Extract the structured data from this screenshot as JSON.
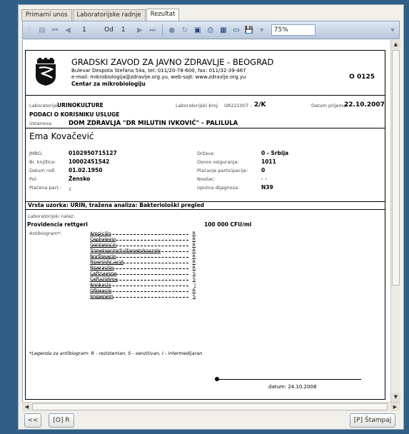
{
  "tabs": [
    {
      "label": "Primarni unos",
      "active": false
    },
    {
      "label": "Laboratorijske radnje",
      "active": false
    },
    {
      "label": "Rezultat",
      "active": true
    }
  ],
  "toolbar": {
    "page_current": "1",
    "page_of_label": "Od",
    "page_total": "1",
    "zoom": "75%"
  },
  "report": {
    "institution_name": "GRADSKI ZAVOD ZA JAVNO ZDRAVLJE - BEOGRAD",
    "address_line": "Bulevar Despota Stefana 54a, tel: 011/20-78-600, fax: 011/32-39-467",
    "contact_line": "e-mail: mikrobiologija@zdravlje.org.yu, web-sajt: www.zdravlje.org.yu",
    "center": "Centar za mikrobiologiju",
    "code": "O 0125",
    "lab_label": "Laboratorija:",
    "lab_value": "URINOKULTURE",
    "labnum_label": "Laboratorijski broj:",
    "labnum_prefix": "UR221007 -",
    "labnum_value": "2/K",
    "date_recv_label": "Datum prijema:",
    "date_recv_value": "22.10.2007",
    "section_user": "PODACI O KORISNIKU USLUGE",
    "institution_label": "Ustanova:",
    "institution_value": "DOM ZDRAVLJA \"DR MILUTIN IVKOVIĆ\" - PALILULA",
    "patient_name": "Ema Kovačević",
    "left_fields": [
      {
        "label": "JMBG:",
        "value": "0102950715127"
      },
      {
        "label": "Br. knjižice:",
        "value": "10002451542"
      },
      {
        "label": "Datum rođ:",
        "value": "01.02.1950"
      },
      {
        "label": "Pol:",
        "value": "Žensko"
      },
      {
        "label": "Plaćena part.:",
        "value": "1"
      }
    ],
    "right_fields": [
      {
        "label": "Država:",
        "value": "0 - Srbija"
      },
      {
        "label": "Osnov osiguranja:",
        "value": "1011"
      },
      {
        "label": "Plaćanje participacije:",
        "value": "0"
      },
      {
        "label": "Nosilac:",
        "value": "- -"
      },
      {
        "label": "Uputna dijagnoza:",
        "value": "N39"
      }
    ],
    "sample_box": "Vrsta uzorka: URIN, tražena analiza: Bakteriološki pregled",
    "finding_label": "Laboratorijski nalaz:",
    "organism": "Providencia rettgeri",
    "count": "100 000 CFU/ml",
    "antibiogram_label": "Antibiogram*:",
    "antibiogram": [
      {
        "name": "Ampicilin",
        "result": "R"
      },
      {
        "name": "Cephalexin",
        "result": "R"
      },
      {
        "name": "Gentamicin",
        "result": "R"
      },
      {
        "name": "Trimetoprim/Sulfametoksazole",
        "result": "R"
      },
      {
        "name": "Norfloxacin",
        "result": "R"
      },
      {
        "name": "Pipemidic acid",
        "result": "R"
      },
      {
        "name": "Piperacilin",
        "result": "R"
      },
      {
        "name": "Ceftriaxone",
        "result": "S"
      },
      {
        "name": "Ceftazidime",
        "result": "S"
      },
      {
        "name": "Amikacin",
        "result": "I"
      },
      {
        "name": "Ofloxacin",
        "result": "R"
      },
      {
        "name": "Imipenem",
        "result": "S"
      }
    ],
    "legend": "*Legenda za antibiogram: R - rezistentan, S - senzitivan, I - intermedijaran",
    "datum_label": "datum:",
    "datum_value": "24.10.2008"
  },
  "bottom": {
    "back_label": "<<",
    "r_label": "[O] R",
    "print_label": "[P] Štampaj"
  }
}
